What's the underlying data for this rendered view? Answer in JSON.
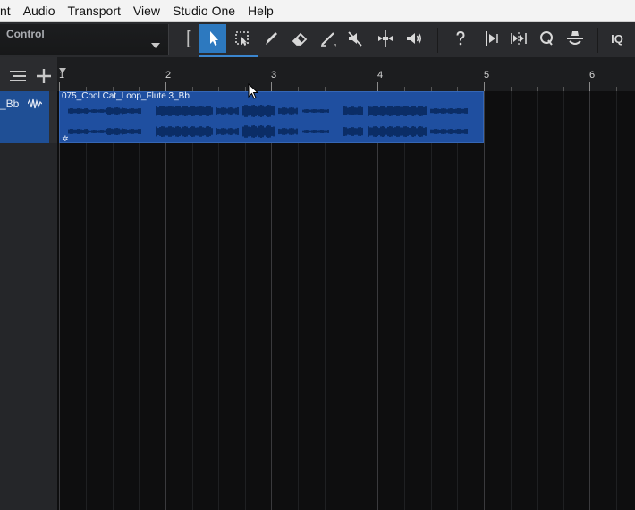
{
  "menu": {
    "items": [
      "nt",
      "Audio",
      "Transport",
      "View",
      "Studio One",
      "Help"
    ]
  },
  "toolbar": {
    "control_label": "Control",
    "bracket": "[",
    "iq_label": "IQ",
    "accent_color": "#2d79bf",
    "tools": [
      {
        "name": "arrow-tool-icon",
        "active": true
      },
      {
        "name": "range-tool-icon",
        "active": false
      },
      {
        "name": "paint-tool-icon",
        "active": false
      },
      {
        "name": "eraser-tool-icon",
        "active": false
      },
      {
        "name": "line-tool-icon",
        "active": false
      },
      {
        "name": "mute-tool-icon",
        "active": false
      },
      {
        "name": "split-tool-icon",
        "active": false
      },
      {
        "name": "listen-tool-icon",
        "active": false
      },
      {
        "name": "help-icon",
        "active": false
      },
      {
        "name": "snap-icon",
        "active": false
      },
      {
        "name": "quantize-icon",
        "active": false
      },
      {
        "name": "q-icon",
        "active": false
      },
      {
        "name": "metronome-icon",
        "active": false
      },
      {
        "name": "iq-button",
        "active": false
      }
    ]
  },
  "track": {
    "name": "_Bb",
    "color": "#1f4f95"
  },
  "ruler": {
    "bars": [
      "1",
      "2",
      "3",
      "4",
      "5",
      "6"
    ]
  },
  "event": {
    "title": "075_Cool Cat_Loop_Flute 3_Bb",
    "gear_symbol": "✲",
    "color": "#1f4fa0"
  }
}
